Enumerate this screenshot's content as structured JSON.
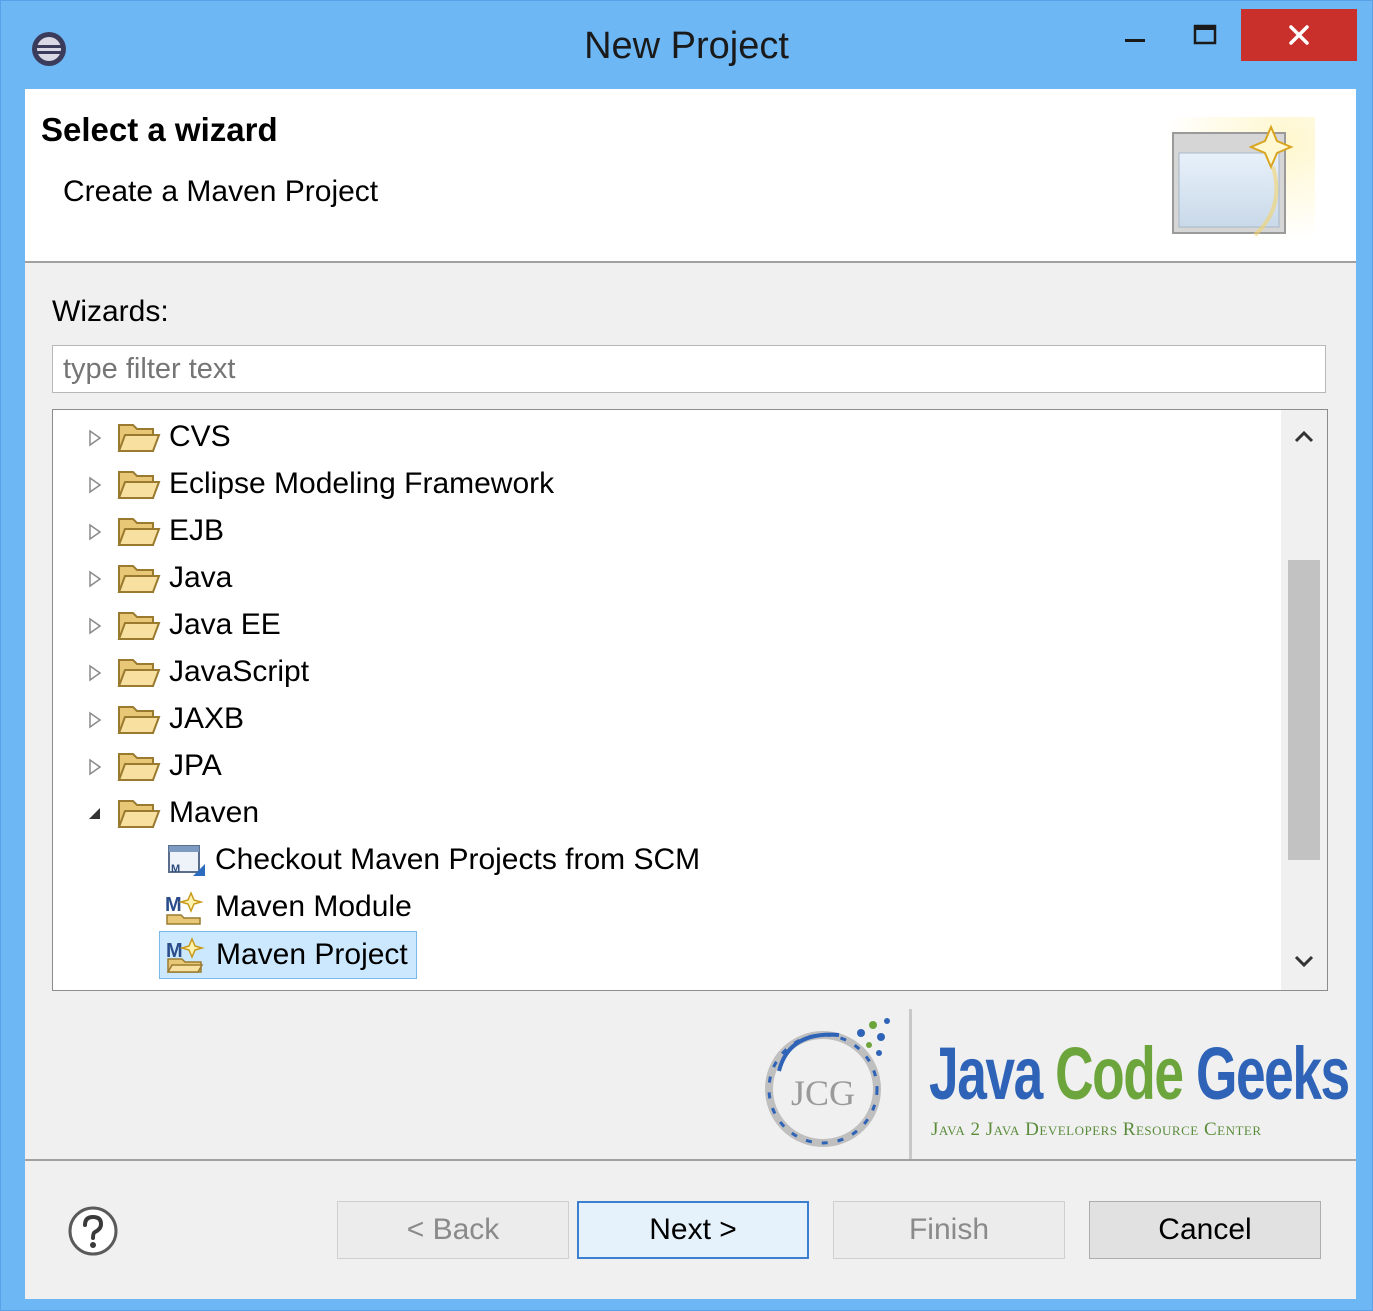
{
  "window": {
    "title": "New Project",
    "controls": [
      "minimize-icon",
      "maximize-icon",
      "close-icon"
    ],
    "close_color": "#c9302c",
    "titlebar_color": "#6db7f5"
  },
  "banner": {
    "title": "Select a wizard",
    "subtitle": "Create a Maven Project"
  },
  "wizards": {
    "label": "Wizards:",
    "filter_placeholder": "type filter text",
    "items": [
      {
        "label": "CVS",
        "expanded": false
      },
      {
        "label": "Eclipse Modeling Framework",
        "expanded": false
      },
      {
        "label": "EJB",
        "expanded": false
      },
      {
        "label": "Java",
        "expanded": false
      },
      {
        "label": "Java EE",
        "expanded": false
      },
      {
        "label": "JavaScript",
        "expanded": false
      },
      {
        "label": "JAXB",
        "expanded": false
      },
      {
        "label": "JPA",
        "expanded": false
      },
      {
        "label": "Maven",
        "expanded": true
      },
      {
        "label": "Checkout Maven Projects from SCM",
        "child": true
      },
      {
        "label": "Maven Module",
        "child": true
      },
      {
        "label": "Maven Project",
        "child": true,
        "selected": true
      }
    ]
  },
  "logo": {
    "name_part1": "Java ",
    "name_part2": "Code",
    "name_part3": " Geeks",
    "tagline": "Java 2 Java Developers Resource Center",
    "monogram": "JCG"
  },
  "buttons": {
    "back": "< Back",
    "next": "Next >",
    "finish": "Finish",
    "cancel": "Cancel"
  }
}
